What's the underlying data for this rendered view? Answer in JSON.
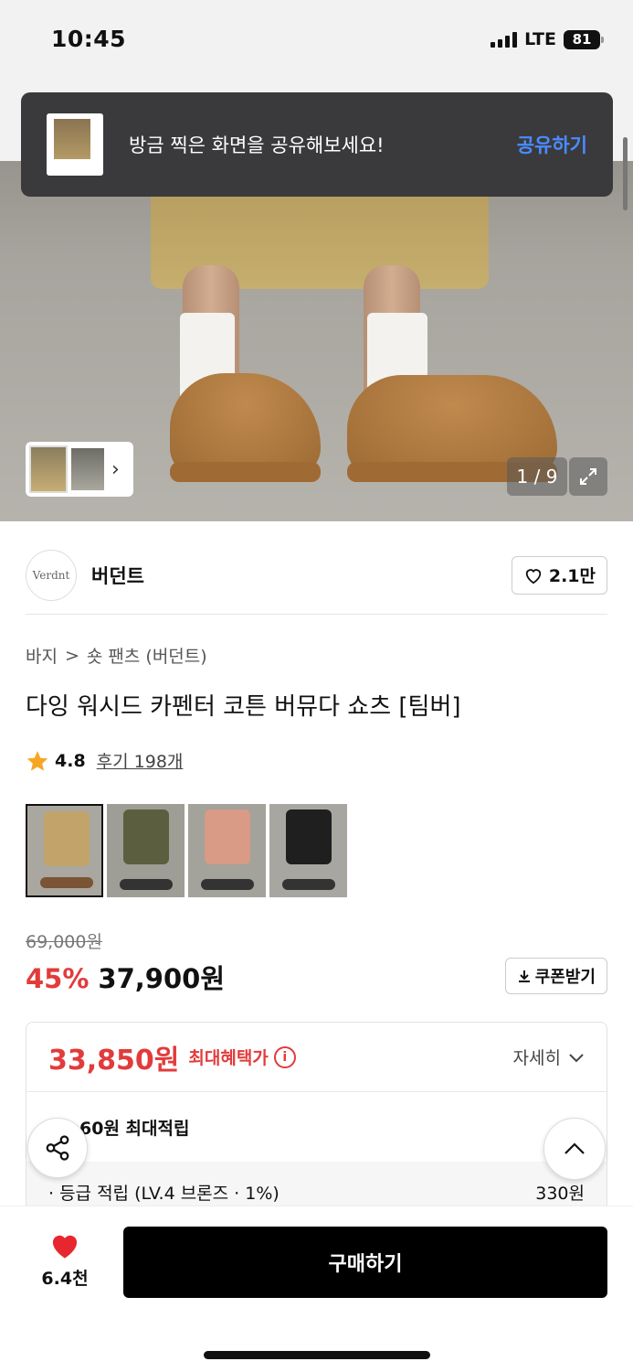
{
  "status": {
    "time": "10:45",
    "network": "LTE",
    "battery": "81"
  },
  "toast": {
    "message": "방금 찍은 화면을 공유해보세요!",
    "action": "공유하기"
  },
  "gallery": {
    "counter": "1 / 9"
  },
  "brand": {
    "name": "버던트",
    "logo_text": "Verdnt",
    "likes": "2.1만"
  },
  "breadcrumb": {
    "category": "바지",
    "separator": ">",
    "subcategory": "숏 팬츠 (버던트)"
  },
  "product": {
    "title": "다잉 워시드 카펜터 코튼 버뮤다 쇼츠 [팀버]",
    "rating": "4.8",
    "reviews": "후기 198개",
    "original_price": "69,000원",
    "discount": "45%",
    "price": "37,900원",
    "coupon_label": "쿠폰받기",
    "color_swatches": [
      "#c2a46a",
      "#5b5f3f",
      "#d99a86",
      "#1f1f1f"
    ]
  },
  "benefit": {
    "max_price": "33,850원",
    "max_label": "최대혜택가",
    "detail_label": "자세히",
    "points_line": "60원 최대적립",
    "grade_label": "· 등급 적립 (LV.4 브론즈 · 1%)",
    "grade_value": "330원"
  },
  "bottom_bar": {
    "wish_count": "6.4천",
    "buy_label": "구매하기"
  },
  "colors": {
    "accent_red": "#e23b3b",
    "link_blue": "#4a8cff",
    "toast_bg": "#3a3a3c"
  }
}
